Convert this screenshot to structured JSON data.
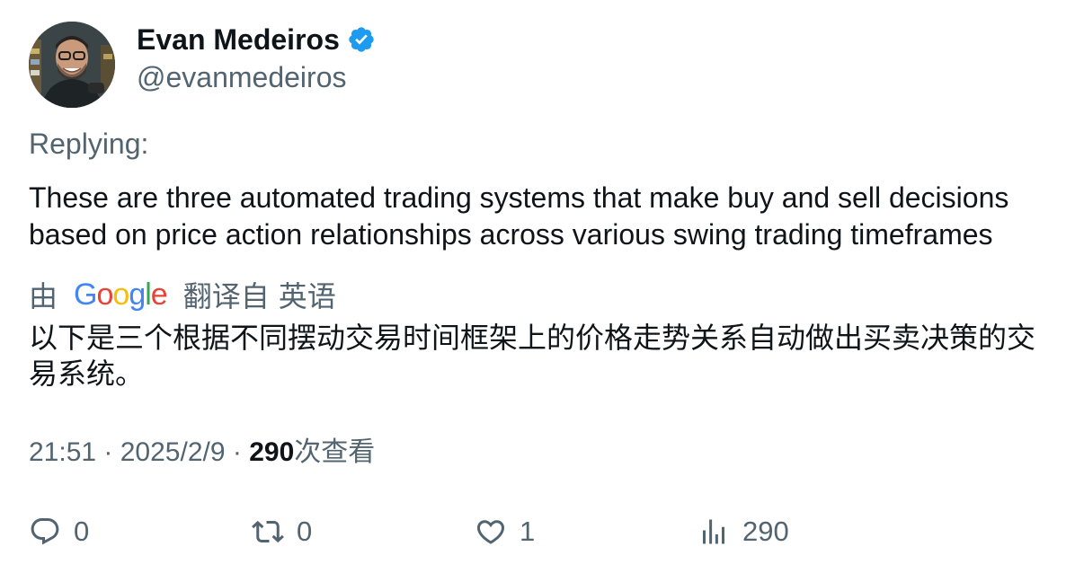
{
  "author": {
    "display_name": "Evan Medeiros",
    "handle": "@evanmedeiros",
    "verified": true,
    "verified_color": "#1d9bf0"
  },
  "replying_label": "Replying:",
  "tweet_text": "These are three automated trading systems that make buy and sell decisions based on price action relationships across various swing trading timeframes",
  "translation": {
    "by_label": "由",
    "provider": "Google",
    "from_label": "翻译自",
    "language": "英语",
    "text": "以下是三个根据不同摆动交易时间框架上的价格走势关系自动做出买卖决策的交易系统。"
  },
  "meta": {
    "time": "21:51",
    "separator": "·",
    "date": "2025/2/9",
    "views_count": "290",
    "views_label": "次查看"
  },
  "actions": {
    "reply": {
      "icon": "reply-icon",
      "count": "0"
    },
    "retweet": {
      "icon": "retweet-icon",
      "count": "0"
    },
    "like": {
      "icon": "heart-icon",
      "count": "1"
    },
    "views": {
      "icon": "bar-chart-icon",
      "count": "290"
    }
  },
  "colors": {
    "text_primary": "#0f1419",
    "text_secondary": "#536471"
  }
}
